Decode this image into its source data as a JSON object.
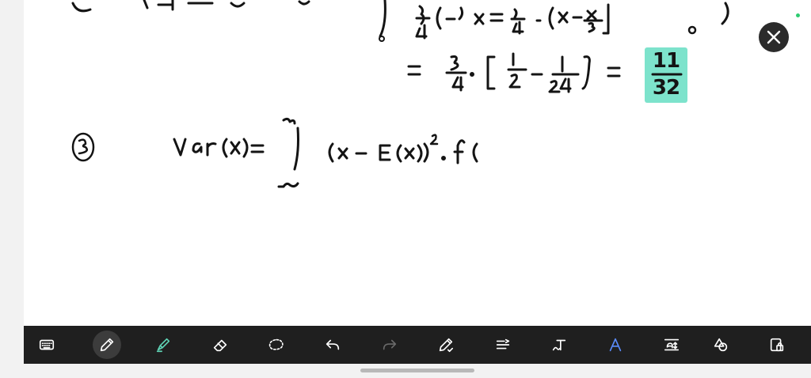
{
  "toolbar": {
    "tools": [
      {
        "name": "keyboard-icon",
        "active": false
      },
      {
        "name": "pen-icon",
        "active": true
      },
      {
        "name": "highlighter-icon",
        "active": false
      },
      {
        "name": "eraser-icon",
        "active": false
      },
      {
        "name": "lasso-icon",
        "active": false
      },
      {
        "name": "undo-icon",
        "active": false
      },
      {
        "name": "redo-icon",
        "active": false,
        "disabled": true
      },
      {
        "name": "pen-settings-icon",
        "active": false
      },
      {
        "name": "line-spacing-icon",
        "active": false
      },
      {
        "name": "text-tool-icon",
        "active": false
      },
      {
        "name": "pencil-text-icon",
        "active": false
      },
      {
        "name": "text-resize-icon",
        "active": false
      },
      {
        "name": "shapes-icon",
        "active": false
      },
      {
        "name": "lock-icon",
        "active": false
      }
    ]
  },
  "canvas": {
    "highlighted_result": {
      "numerator": "11",
      "denominator": "32"
    }
  },
  "colors": {
    "ink": "#141414",
    "highlight": "#7de3cc",
    "toolbar": "#1f1f1f",
    "canvas": "#ffffff",
    "status_dot": "#2ecc71"
  }
}
